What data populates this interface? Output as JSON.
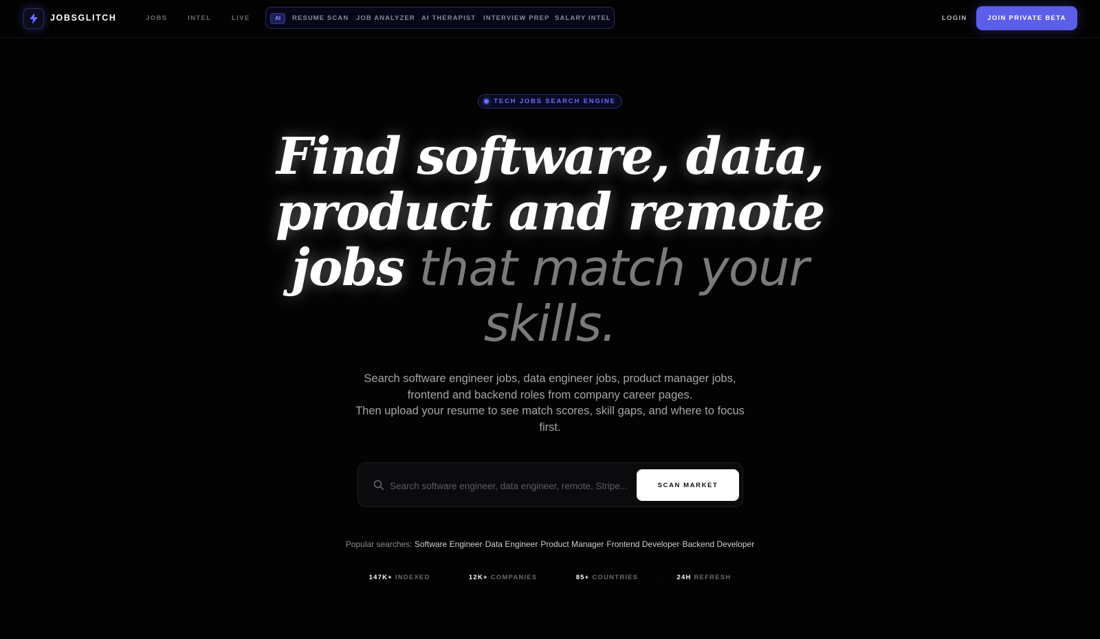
{
  "nav": {
    "brand": "JOBSGLITCH",
    "links": [
      "JOBS",
      "INTEL",
      "LIVE"
    ],
    "ai_badge": "AI",
    "ai_links": [
      "RESUME SCAN",
      "JOB ANALYZER",
      "AI THERAPIST",
      "INTERVIEW PREP",
      "SALARY INTEL"
    ],
    "login": "LOGIN",
    "cta": "JOIN PRIVATE BETA",
    "accent_color": "#5b5ee8"
  },
  "hero": {
    "badge": "TECH JOBS SEARCH ENGINE",
    "headline_bright": [
      "Find software, data,",
      "product and remote",
      "jobs"
    ],
    "headline_dim_inline": "that match your",
    "headline_dim_last": "skills.",
    "subtitle_1": "Search software engineer jobs, data engineer jobs, product manager jobs, frontend and backend roles from company career pages.",
    "subtitle_2": "Then upload your resume to see match scores, skill gaps, and where to focus first."
  },
  "search": {
    "placeholder": "Search software engineer, data engineer, remote, Stripe...",
    "value": "",
    "button": "SCAN MARKET"
  },
  "popular": {
    "label": "Popular searches:",
    "items": [
      "Software Engineer",
      "Data Engineer",
      "Product Manager",
      "Frontend Developer",
      "Backend Developer"
    ],
    "separator": "·"
  },
  "stats": [
    {
      "value": "147K+",
      "label": "INDEXED"
    },
    {
      "value": "12K+",
      "label": "COMPANIES"
    },
    {
      "value": "85+",
      "label": "COUNTRIES"
    },
    {
      "value": "24H",
      "label": "REFRESH"
    }
  ]
}
